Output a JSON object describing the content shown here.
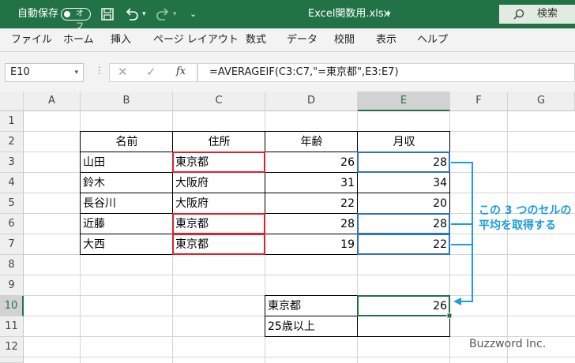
{
  "titlebar": {
    "autosave_label": "自動保存",
    "autosave_state": "オフ",
    "filename": "Excel関数用.xlsx",
    "search_label": "検索"
  },
  "menu": [
    "ファイル",
    "ホーム",
    "挿入",
    "ページ レイアウト",
    "数式",
    "データ",
    "校閲",
    "表示",
    "ヘルプ"
  ],
  "formula_bar": {
    "name_box": "E10",
    "fx_label": "fx",
    "formula": "=AVERAGEIF(C3:C7,\"=東京都\",E3:E7)"
  },
  "columns": [
    "A",
    "B",
    "C",
    "D",
    "E",
    "F",
    "G"
  ],
  "rows": [
    "1",
    "2",
    "3",
    "4",
    "5",
    "6",
    "7",
    "8",
    "9",
    "10",
    "11",
    "12"
  ],
  "selected_cell": "E10",
  "table": {
    "headers": [
      "名前",
      "住所",
      "年齢",
      "月収"
    ],
    "records": [
      [
        "山田",
        "東京都",
        "26",
        "28"
      ],
      [
        "鈴木",
        "大阪府",
        "31",
        "34"
      ],
      [
        "長谷川",
        "大阪府",
        "22",
        "20"
      ],
      [
        "近藤",
        "東京都",
        "28",
        "28"
      ],
      [
        "大西",
        "東京都",
        "19",
        "22"
      ]
    ]
  },
  "result_table": [
    [
      "東京都",
      "26"
    ],
    [
      "25歳以上",
      ""
    ]
  ],
  "annotation": {
    "line1": "この 3 つのセルの",
    "line2": "平均を取得する",
    "color": "#1e9ce0"
  },
  "highlight_colors": {
    "address": "#d9232e",
    "income": "#2e75b6",
    "accent": "#217346"
  },
  "watermark": "Buzzword Inc."
}
